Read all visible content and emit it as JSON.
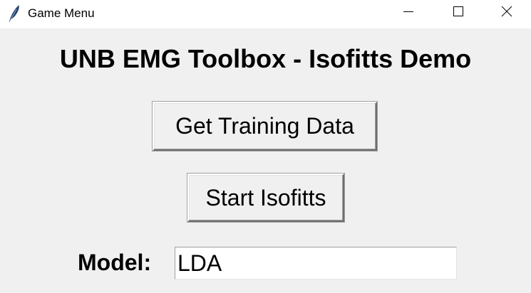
{
  "window": {
    "title": "Game Menu",
    "icon": "feather-icon",
    "controls": {
      "minimize_icon": "minimize-icon",
      "maximize_icon": "maximize-icon",
      "close_icon": "close-icon"
    }
  },
  "main": {
    "heading": "UNB EMG Toolbox - Isofitts Demo",
    "buttons": {
      "get_training_data": "Get Training Data",
      "start_isofitts": "Start Isofitts"
    },
    "model": {
      "label": "Model:",
      "value": "LDA"
    }
  },
  "colors": {
    "background": "#f0f0f0",
    "titlebar": "#ffffff",
    "entry_background": "#ffffff",
    "text": "#000000"
  }
}
